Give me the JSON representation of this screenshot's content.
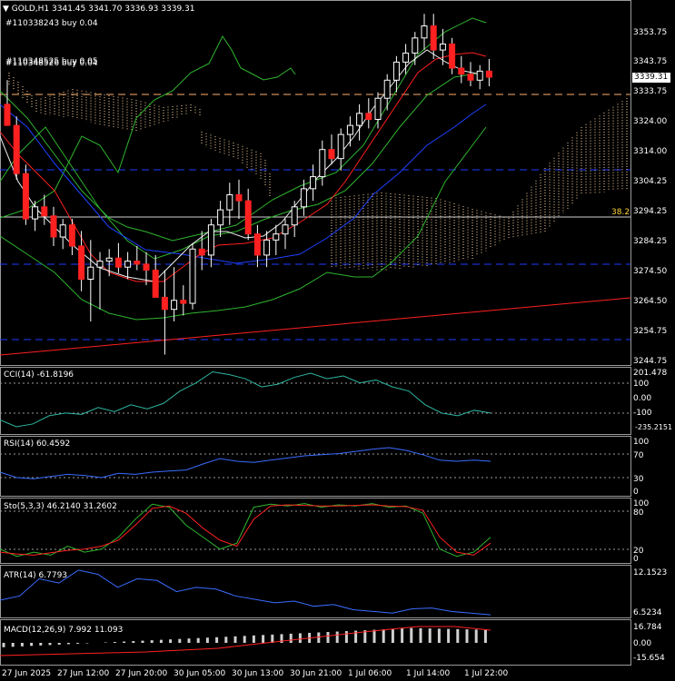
{
  "header": {
    "symbol": "GOLD,H1",
    "ohlc": "3341.45 3341.70 3336.93 3339.31",
    "order1": "#110338243 buy 0.04",
    "order2": "#110348525 buy 0.05",
    "order3": "#110348526 buy 0.04"
  },
  "price": {
    "current": "3339.31",
    "fib_label": "38.2",
    "axis": [
      "3353.75",
      "3343.75",
      "3333.75",
      "3324.00",
      "3314.00",
      "3304.25",
      "3294.25",
      "3284.25",
      "3274.50",
      "3264.50",
      "3254.75",
      "3244.75"
    ]
  },
  "panels": {
    "cci": {
      "title": "CCI(14) -61.8196",
      "axis": [
        "201.478",
        "100",
        "0.00",
        "-100",
        "-235.2151"
      ]
    },
    "rsi": {
      "title": "RSI(14) 60.4592",
      "axis": [
        "100",
        "70",
        "30",
        "0"
      ]
    },
    "sto": {
      "title": "Sto(5,3,3) 46.2140 31.2602",
      "axis": [
        "100",
        "80",
        "20",
        "0"
      ]
    },
    "atr": {
      "title": "ATR(14) 6.7793",
      "axis": [
        "12.1523",
        "6.5234"
      ]
    },
    "macd": {
      "title": "MACD(12,26,9) 7.992 11.093",
      "axis": [
        "16.784",
        "0.00",
        "-15.654"
      ]
    }
  },
  "xaxis": [
    "27 Jun 2025",
    "27 Jun 12:00",
    "27 Jun 20:00",
    "30 Jun 05:00",
    "30 Jun 13:00",
    "30 Jun 21:00",
    "1 Jul 06:00",
    "1 Jul 14:00",
    "1 Jul 22:00"
  ],
  "candles": [
    [
      3330,
      3338,
      3326,
      3323
    ],
    [
      3323,
      3326,
      3305,
      3307
    ],
    [
      3307,
      3310,
      3290,
      3292
    ],
    [
      3292,
      3298,
      3288,
      3296
    ],
    [
      3296,
      3300,
      3290,
      3293
    ],
    [
      3293,
      3296,
      3283,
      3286
    ],
    [
      3286,
      3292,
      3282,
      3290
    ],
    [
      3290,
      3292,
      3280,
      3283
    ],
    [
      3283,
      3288,
      3268,
      3272
    ],
    [
      3272,
      3285,
      3258,
      3276
    ],
    [
      3276,
      3281,
      3262,
      3278
    ],
    [
      3278,
      3282,
      3273,
      3279
    ],
    [
      3279,
      3284,
      3274,
      3276
    ],
    [
      3276,
      3281,
      3272,
      3278
    ],
    [
      3278,
      3283,
      3275,
      3277
    ],
    [
      3277,
      3281,
      3270,
      3275
    ],
    [
      3275,
      3280,
      3268,
      3266
    ],
    [
      3266,
      3275,
      3247,
      3262
    ],
    [
      3262,
      3276,
      3258,
      3265
    ],
    [
      3265,
      3270,
      3260,
      3264
    ],
    [
      3264,
      3284,
      3262,
      3282
    ],
    [
      3282,
      3288,
      3275,
      3280
    ],
    [
      3280,
      3292,
      3276,
      3290
    ],
    [
      3290,
      3298,
      3286,
      3295
    ],
    [
      3295,
      3304,
      3290,
      3300
    ],
    [
      3300,
      3305,
      3292,
      3298
    ],
    [
      3298,
      3302,
      3285,
      3287
    ],
    [
      3287,
      3290,
      3276,
      3280
    ],
    [
      3280,
      3288,
      3276,
      3285
    ],
    [
      3285,
      3290,
      3280,
      3287
    ],
    [
      3287,
      3292,
      3282,
      3290
    ],
    [
      3290,
      3298,
      3286,
      3296
    ],
    [
      3296,
      3305,
      3293,
      3302
    ],
    [
      3302,
      3310,
      3298,
      3306
    ],
    [
      3306,
      3318,
      3303,
      3315
    ],
    [
      3315,
      3320,
      3310,
      3312
    ],
    [
      3312,
      3322,
      3308,
      3320
    ],
    [
      3320,
      3326,
      3316,
      3323
    ],
    [
      3323,
      3330,
      3318,
      3327
    ],
    [
      3327,
      3332,
      3322,
      3325
    ],
    [
      3325,
      3334,
      3322,
      3332
    ],
    [
      3332,
      3340,
      3328,
      3338
    ],
    [
      3338,
      3346,
      3334,
      3344
    ],
    [
      3344,
      3350,
      3340,
      3347
    ],
    [
      3347,
      3354,
      3343,
      3352
    ],
    [
      3352,
      3360,
      3348,
      3356
    ],
    [
      3356,
      3360,
      3345,
      3348
    ],
    [
      3348,
      3355,
      3343,
      3350
    ],
    [
      3350,
      3352,
      3340,
      3342
    ],
    [
      3342,
      3346,
      3337,
      3340
    ],
    [
      3340,
      3344,
      3336,
      3338
    ],
    [
      3338,
      3343,
      3335,
      3341
    ],
    [
      3341,
      3345,
      3336,
      3339
    ]
  ],
  "colors": {
    "bull": "#ffffff",
    "bear": "#ff2020",
    "grid_dash": "#1e3cff",
    "trend": "#ff2020",
    "cloud": "#ffd7a0"
  }
}
